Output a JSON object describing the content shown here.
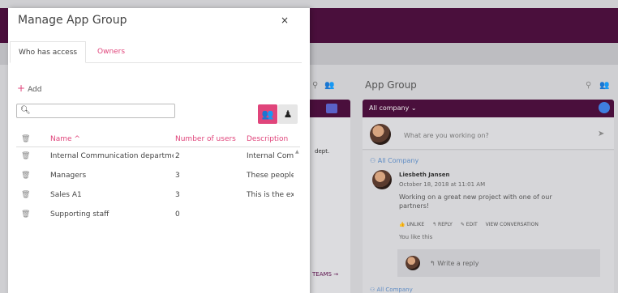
{
  "modal": {
    "title": "Manage App Group",
    "close_label": "×",
    "tabs": [
      {
        "label": "Who has access",
        "active": true
      },
      {
        "label": "Owners",
        "active": false
      }
    ],
    "add_label": "Add",
    "search": {
      "placeholder": "",
      "value": ""
    },
    "table": {
      "columns": [
        "Name ^",
        "Number of users",
        "Description"
      ],
      "rows": [
        {
          "name": "Internal Communication department",
          "users": "2",
          "description": "Internal Comm"
        },
        {
          "name": "Managers",
          "users": "3",
          "description": "These people"
        },
        {
          "name": "Sales A1",
          "users": "3",
          "description": "This is the ext"
        },
        {
          "name": "Supporting staff",
          "users": "0",
          "description": ""
        }
      ]
    }
  },
  "background": {
    "left_dept": "dept.",
    "left_teams": "TEAMS →",
    "group_title": "App Group",
    "group_bar_label": "All company ⌄",
    "post_placeholder": "What are you working on?",
    "feed": {
      "group": "All Company",
      "author": "Liesbeth Jansen",
      "date": "October 18, 2018 at 11:01 AM",
      "text": "Working on a great new project with one of our partners!",
      "actions": [
        "UNLIKE",
        "REPLY",
        "EDIT",
        "VIEW CONVERSATION"
      ],
      "likes": "You like this",
      "reply_placeholder": "Write a reply",
      "next_group": "All Company"
    }
  },
  "colors": {
    "accent": "#e0457b",
    "brand": "#4a0f3c"
  }
}
